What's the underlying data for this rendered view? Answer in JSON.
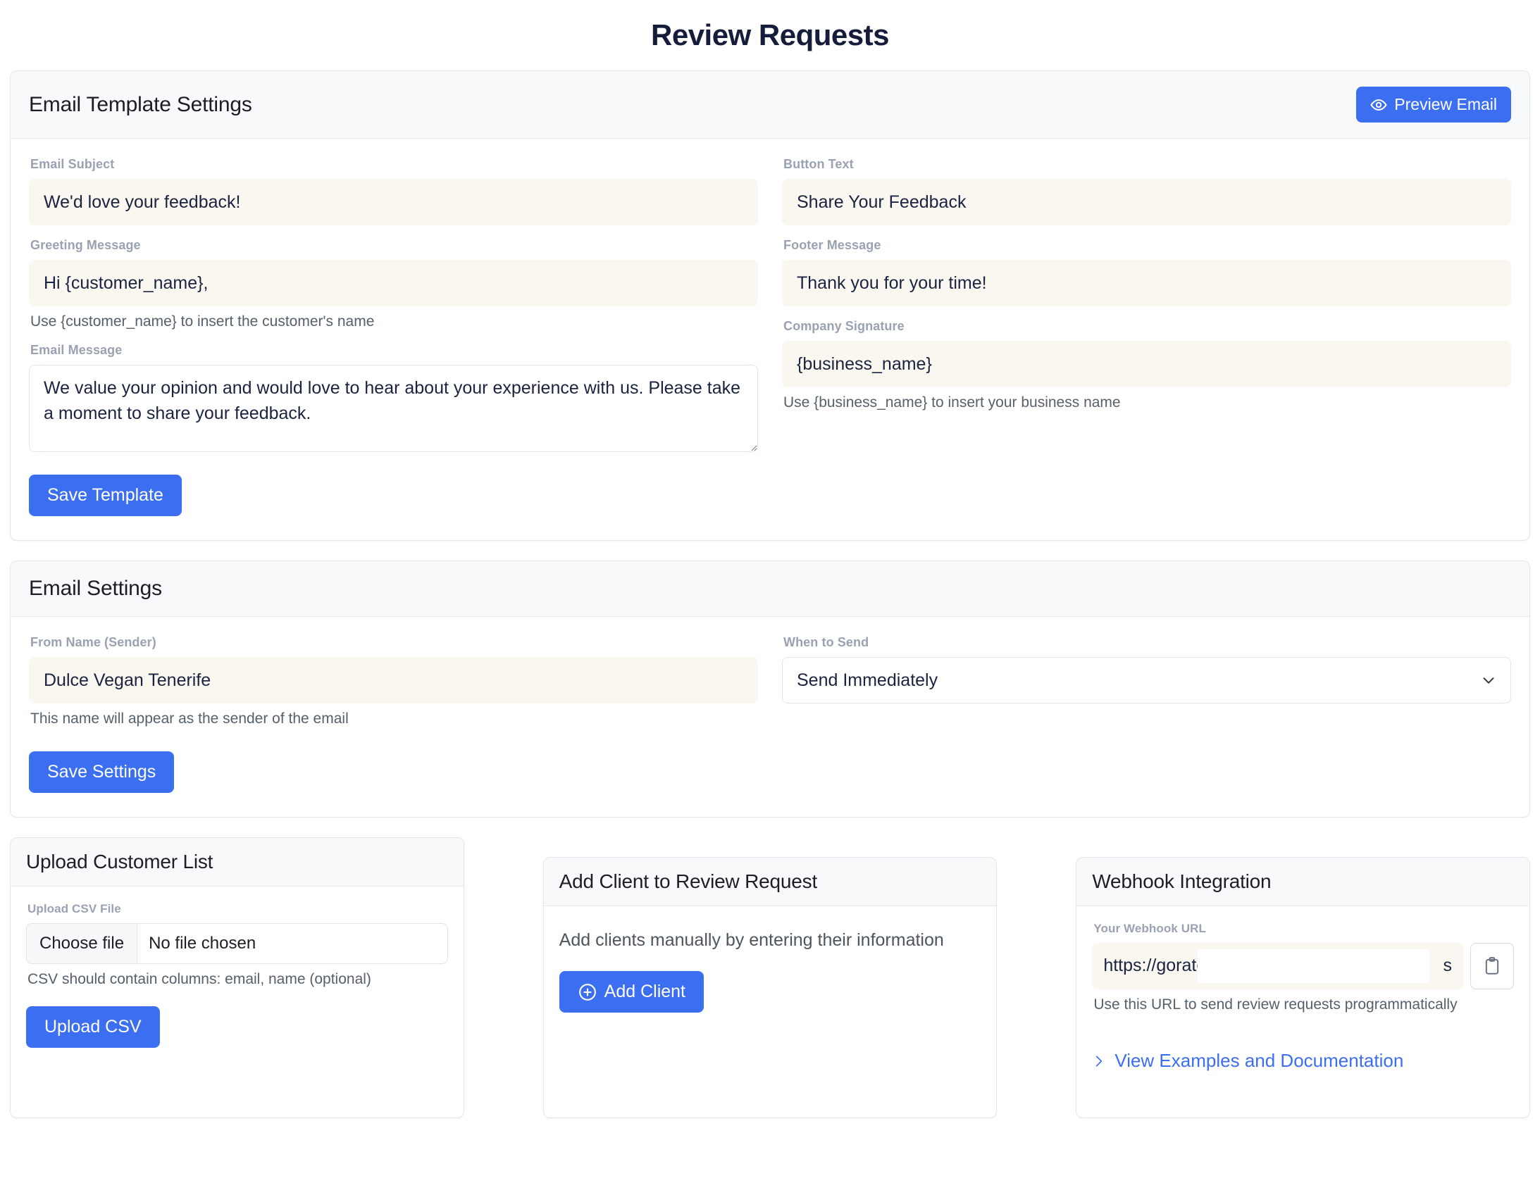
{
  "page": {
    "title": "Review Requests"
  },
  "template_card": {
    "title": "Email Template Settings",
    "preview_button": "Preview Email",
    "preview_icon": "eye-icon",
    "fields": {
      "email_subject": {
        "label": "Email Subject",
        "value": "We'd love your feedback!"
      },
      "greeting_message": {
        "label": "Greeting Message",
        "value": "Hi {customer_name},",
        "help": "Use {customer_name} to insert the customer's name"
      },
      "email_message": {
        "label": "Email Message",
        "value": "We value your opinion and would love to hear about your experience with us. Please take a moment to share your feedback."
      },
      "button_text": {
        "label": "Button Text",
        "value": "Share Your Feedback"
      },
      "footer_message": {
        "label": "Footer Message",
        "value": "Thank you for your time!"
      },
      "company_signature": {
        "label": "Company Signature",
        "value": "{business_name}",
        "help": "Use {business_name} to insert your business name"
      }
    },
    "save_button": "Save Template"
  },
  "settings_card": {
    "title": "Email Settings",
    "from_name": {
      "label": "From Name (Sender)",
      "value": "Dulce Vegan Tenerife",
      "help": "This name will appear as the sender of the email"
    },
    "when_to_send": {
      "label": "When to Send",
      "selected": "Send Immediately",
      "options": [
        "Send Immediately"
      ]
    },
    "save_button": "Save Settings"
  },
  "upload_card": {
    "title": "Upload Customer List",
    "file_label": "Upload CSV File",
    "choose_file_button": "Choose file",
    "file_status": "No file chosen",
    "help": "CSV should contain columns: email, name (optional)",
    "upload_button": "Upload CSV"
  },
  "add_client_card": {
    "title": "Add Client to Review Request",
    "description": "Add clients manually by entering their information",
    "add_button": "Add Client",
    "add_icon": "plus-circle-icon"
  },
  "webhook_card": {
    "title": "Webhook Integration",
    "url_label": "Your Webhook URL",
    "url_prefix": "https://gorate.",
    "url_suffix": "s",
    "url_redacted": true,
    "copy_icon": "clipboard-icon",
    "help": "Use this URL to send review requests programmatically",
    "docs_link": "View Examples and Documentation",
    "docs_icon": "chevron-right-icon"
  },
  "colors": {
    "accent": "#3b6ef0",
    "title": "#161d3b",
    "input_bg": "#faf7f0",
    "header_bg": "#f8f9fa",
    "label": "#9aa1b1"
  }
}
